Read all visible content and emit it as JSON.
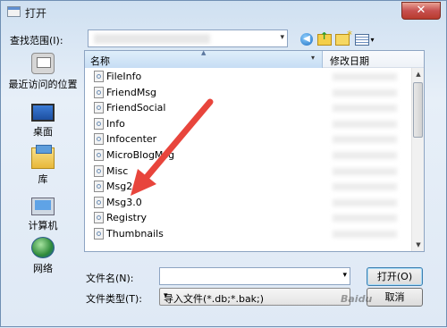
{
  "window": {
    "title": "打开",
    "close_glyph": "✕"
  },
  "lookin": {
    "label": "查找范围(I):",
    "value": ""
  },
  "toolbar": {
    "back": "◀",
    "dropdown": "▾"
  },
  "places": [
    {
      "label": "最近访问的位置",
      "icon": "recent-places-icon"
    },
    {
      "label": "桌面",
      "icon": "desktop-icon"
    },
    {
      "label": "库",
      "icon": "library-icon"
    },
    {
      "label": "计算机",
      "icon": "computer-icon"
    },
    {
      "label": "网络",
      "icon": "network-icon"
    }
  ],
  "list": {
    "columns": {
      "name": "名称",
      "date": "修改日期"
    },
    "sort_glyph": "▲",
    "col_dropdown": "▾",
    "files": [
      "FileInfo",
      "FriendMsg",
      "FriendSocial",
      "Info",
      "Infocenter",
      "MicroBlogMsg",
      "Misc",
      "Msg2.0",
      "Msg3.0",
      "Registry",
      "Thumbnails"
    ],
    "scroll_up": "▲",
    "scroll_down": "▼"
  },
  "filename": {
    "label": "文件名(N):",
    "value": "",
    "arrow": "▾"
  },
  "filetype": {
    "label": "文件类型(T):",
    "value": "导入文件(*.db;*.bak;)",
    "arrow": "▾"
  },
  "buttons": {
    "open": "打开(O)",
    "cancel": "取消"
  },
  "watermark": "Baidu",
  "colors": {
    "annotation_arrow": "#e8453c",
    "header_blue": "#c6ddf4",
    "border": "#8da4c2"
  }
}
